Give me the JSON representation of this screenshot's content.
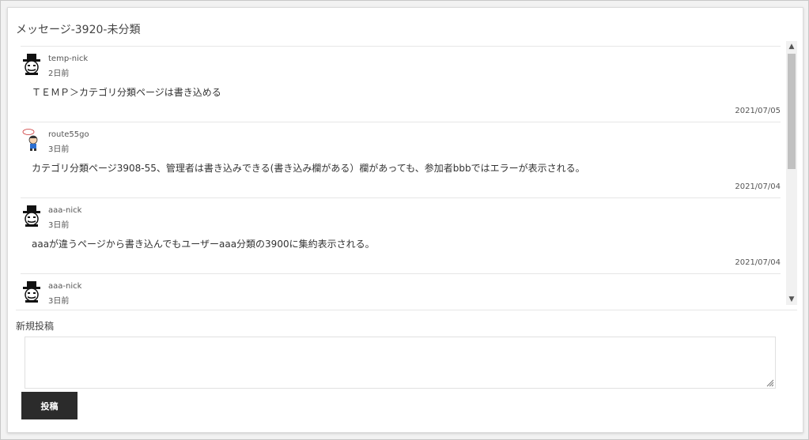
{
  "page": {
    "title": "メッセージ-3920-未分類"
  },
  "messages": [
    {
      "user": "temp-nick",
      "age": "2日前",
      "body": "ＴＥＭＰ＞カテゴリ分類ページは書き込める",
      "date": "2021/07/05",
      "avatar": "hat-mustache-avatar-icon"
    },
    {
      "user": "route55go",
      "age": "3日前",
      "body": "カテゴリ分類ページ3908-55、管理者は書き込みできる(書き込み欄がある）欄があっても、参加者bbbではエラーが表示される。",
      "date": "2021/07/04",
      "avatar": "boy-character-avatar-icon"
    },
    {
      "user": "aaa-nick",
      "age": "3日前",
      "body": "aaaが違うページから書き込んでもユーザーaaa分類の3900に集約表示される。",
      "date": "2021/07/04",
      "avatar": "hat-mustache-avatar-icon"
    },
    {
      "user": "aaa-nick",
      "age": "3日前",
      "body": "",
      "date": "",
      "avatar": "hat-mustache-avatar-icon"
    }
  ],
  "composer": {
    "label": "新規投稿",
    "value": "",
    "submit_label": "投稿"
  }
}
